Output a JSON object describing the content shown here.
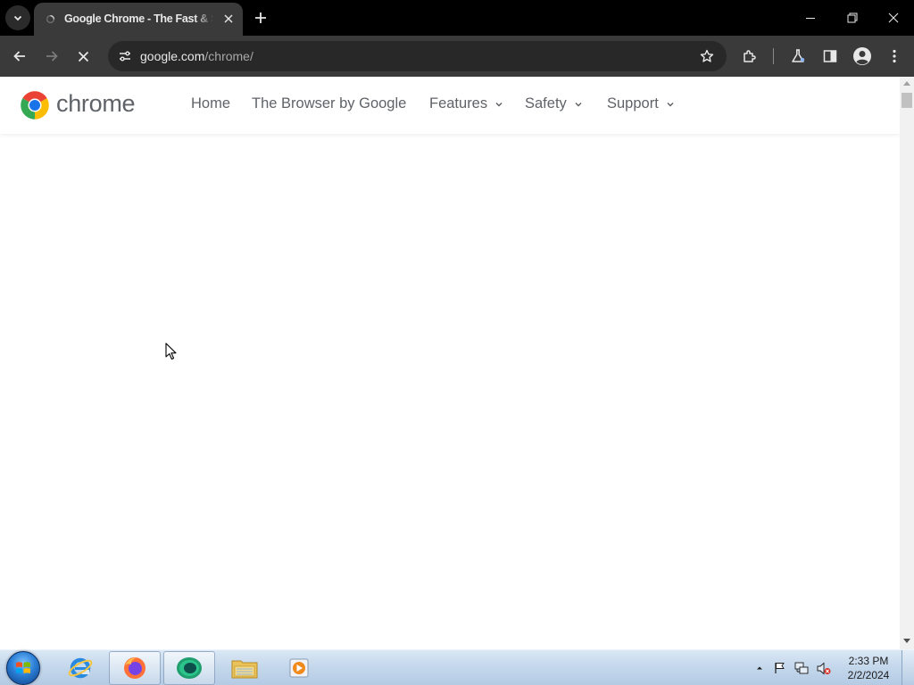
{
  "browser": {
    "tab": {
      "title": "Google Chrome - The Fast & Secure Web Browser Built to be Yours",
      "favicon": "loading-spinner-icon"
    },
    "address_bar": {
      "domain": "google.com",
      "path": "/chrome/"
    },
    "window_controls": [
      "minimize-icon",
      "restore-icon",
      "close-icon"
    ]
  },
  "page": {
    "logo_text": "chrome",
    "nav": {
      "home": "Home",
      "browser_by_google": "The Browser by Google",
      "features": "Features",
      "safety": "Safety",
      "support": "Support"
    }
  },
  "taskbar": {
    "pinned": [
      "internet-explorer-icon",
      "firefox-icon",
      "chrome-icon",
      "file-explorer-icon",
      "media-player-icon"
    ],
    "clock": {
      "time": "2:33 PM",
      "date": "2/2/2024"
    }
  },
  "colors": {
    "tab_strip": "#000000",
    "toolbar": "#3a3a3a",
    "omnibox": "#282828",
    "nav_text": "#5f6368",
    "chrome_red": "#ea4335",
    "chrome_green": "#34a853",
    "chrome_yellow": "#fbbc04",
    "chrome_blue": "#1a73e8"
  }
}
